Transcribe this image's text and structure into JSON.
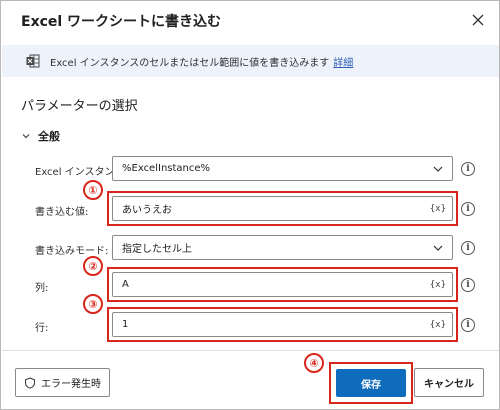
{
  "dialog": {
    "title": "Excel ワークシートに書き込む",
    "info_text": "Excel インスタンスのセルまたはセル範囲に値を書き込みます",
    "info_link": "詳細",
    "section_title": "パラメーターの選択",
    "group_label": "全般"
  },
  "fields": {
    "instance": {
      "label": "Excel インスタンス:",
      "value": "%ExcelInstance%"
    },
    "value": {
      "label": "書き込む値:",
      "value": "あいうえお",
      "var_button": "{x}"
    },
    "mode": {
      "label": "書き込みモード:",
      "value": "指定したセル上"
    },
    "column": {
      "label": "列:",
      "value": "A",
      "var_button": "{x}"
    },
    "row": {
      "label": "行:",
      "value": "1",
      "var_button": "{x}"
    }
  },
  "annotations": {
    "n1": "①",
    "n2": "②",
    "n3": "③",
    "n4": "④"
  },
  "footer": {
    "error_button": "エラー発生時",
    "save_button": "保存",
    "cancel_button": "キャンセル"
  },
  "info_glyph": "i",
  "colors": {
    "accent": "#0f6cbd",
    "highlight": "#d9261c",
    "info_bar": "#eef3fb",
    "excel_green": "#1d6f42"
  },
  "icons": {
    "close": "close-icon",
    "excel": "excel-icon",
    "chevron": "chevron-down-icon",
    "dropdown": "dropdown-icon",
    "info": "info-icon",
    "shield": "shield-icon"
  }
}
